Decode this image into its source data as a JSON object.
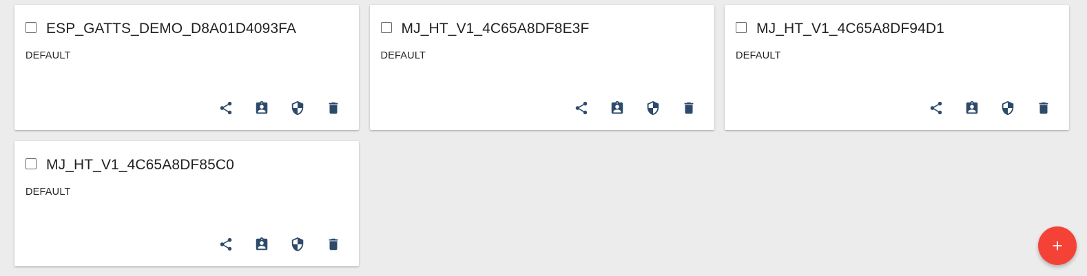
{
  "devices": [
    {
      "name": "ESP_GATTS_DEMO_D8A01D4093FA",
      "group": "DEFAULT"
    },
    {
      "name": "MJ_HT_V1_4C65A8DF8E3F",
      "group": "DEFAULT"
    },
    {
      "name": "MJ_HT_V1_4C65A8DF94D1",
      "group": "DEFAULT"
    },
    {
      "name": "MJ_HT_V1_4C65A8DF85C0",
      "group": "DEFAULT"
    }
  ],
  "card_actions": [
    "share-icon",
    "assignment-ind-icon",
    "security-shield-icon",
    "delete-icon"
  ],
  "colors": {
    "background": "#ececec",
    "card": "#ffffff",
    "icon": "#2d4a6b",
    "fab": "#f44336"
  },
  "fab": {
    "icon": "plus-icon"
  }
}
